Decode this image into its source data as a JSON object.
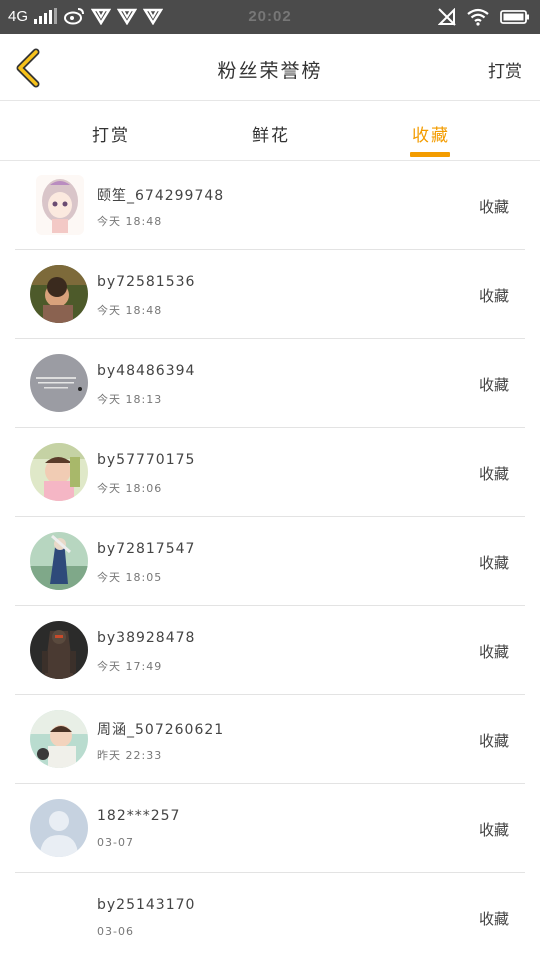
{
  "status_bar": {
    "network": "4G",
    "time": "20:02",
    "icons": [
      "signal-icon",
      "weibo-icon",
      "app-icon",
      "app-icon",
      "app-icon",
      "no-sim-icon",
      "wifi-icon",
      "battery-icon"
    ]
  },
  "header": {
    "title": "粉丝荣誉榜",
    "right_action": "打赏",
    "back_icon": "chevron-left-icon",
    "accent_color": "#f39c00"
  },
  "tabs": [
    {
      "label": "打赏",
      "active": false
    },
    {
      "label": "鲜花",
      "active": false
    },
    {
      "label": "收藏",
      "active": true
    }
  ],
  "entries": [
    {
      "name": "颐笙_674299748",
      "time": "今天 18:48",
      "action": "收藏"
    },
    {
      "name": "by72581536",
      "time": "今天 18:48",
      "action": "收藏"
    },
    {
      "name": "by48486394",
      "time": "今天 18:13",
      "action": "收藏"
    },
    {
      "name": "by57770175",
      "time": "今天 18:06",
      "action": "收藏"
    },
    {
      "name": "by72817547",
      "time": "今天 18:05",
      "action": "收藏"
    },
    {
      "name": "by38928478",
      "time": "今天 17:49",
      "action": "收藏"
    },
    {
      "name": "周涵_507260621",
      "time": "昨天 22:33",
      "action": "收藏"
    },
    {
      "name": "182***257",
      "time": "03-07",
      "action": "收藏"
    },
    {
      "name": "by25143170",
      "time": "03-06",
      "action": "收藏"
    }
  ]
}
